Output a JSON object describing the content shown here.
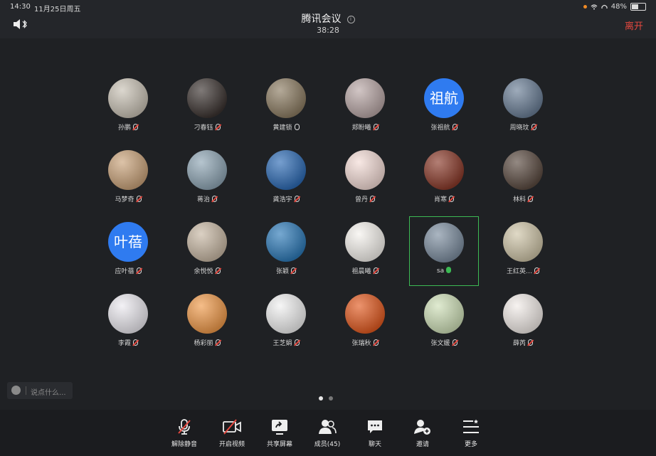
{
  "status": {
    "time": "14:30",
    "date": "11月25日周五",
    "battery": "48%"
  },
  "header": {
    "title": "腾讯会议",
    "timer": "38:28",
    "leave_label": "离开"
  },
  "participants": [
    {
      "name": "孙鹏",
      "mic": "muted",
      "bg": "#c9c2b5"
    },
    {
      "name": "刁春钰",
      "mic": "muted",
      "bg": "#3b3330"
    },
    {
      "name": "黄建锁",
      "mic": "off",
      "bg": "#8c7c62"
    },
    {
      "name": "郑盼曦",
      "mic": "muted",
      "bg": "#b9a7a6"
    },
    {
      "name": "张祖航",
      "mic": "muted",
      "bg": "#2f7bf0",
      "text": "祖航"
    },
    {
      "name": "周晓玟",
      "mic": "muted",
      "bg": "#6a7e96"
    },
    {
      "name": "马梦奇",
      "mic": "muted",
      "bg": "#caa37a"
    },
    {
      "name": "蒋治",
      "mic": "muted",
      "bg": "#8fa6b5"
    },
    {
      "name": "龚浩宇",
      "mic": "muted",
      "bg": "#2d6bb5"
    },
    {
      "name": "曾丹",
      "mic": "muted",
      "bg": "#f4dcd6"
    },
    {
      "name": "肖寒",
      "mic": "muted",
      "bg": "#8a3a2a"
    },
    {
      "name": "林科",
      "mic": "muted",
      "bg": "#5a4a40"
    },
    {
      "name": "应叶蓓",
      "mic": "muted",
      "bg": "#2f7bf0",
      "text": "叶蓓"
    },
    {
      "name": "余悦悦",
      "mic": "muted",
      "bg": "#c8b8a4"
    },
    {
      "name": "张颖",
      "mic": "muted",
      "bg": "#2d7ab8"
    },
    {
      "name": "祖晨曦",
      "mic": "muted",
      "bg": "#f6f3ee"
    },
    {
      "name": "sa",
      "mic": "on",
      "bg": "#7d8ea0",
      "active": true
    },
    {
      "name": "王红英…",
      "mic": "muted",
      "bg": "#cfc5a8"
    },
    {
      "name": "李霞",
      "mic": "muted",
      "bg": "#eceaf0"
    },
    {
      "name": "杨彩丽",
      "mic": "muted",
      "bg": "#f09a4a"
    },
    {
      "name": "王芝娟",
      "mic": "muted",
      "bg": "#f1f1f1"
    },
    {
      "name": "张瑞秋",
      "mic": "muted",
      "bg": "#e25a20"
    },
    {
      "name": "张文媛",
      "mic": "muted",
      "bg": "#cfe0b8"
    },
    {
      "name": "薛芮",
      "mic": "muted",
      "bg": "#f2ece8"
    }
  ],
  "chat": {
    "placeholder": "说点什么..."
  },
  "pages": {
    "current": 1,
    "total": 2
  },
  "toolbar": {
    "unmute": "解除静音",
    "video": "开启视频",
    "share": "共享屏幕",
    "members": "成员(45)",
    "chat": "聊天",
    "invite": "邀请",
    "more": "更多"
  },
  "colors": {
    "accent_green": "#3cba54",
    "leave_red": "#e5483f",
    "avatar_blue": "#2f7bf0"
  }
}
